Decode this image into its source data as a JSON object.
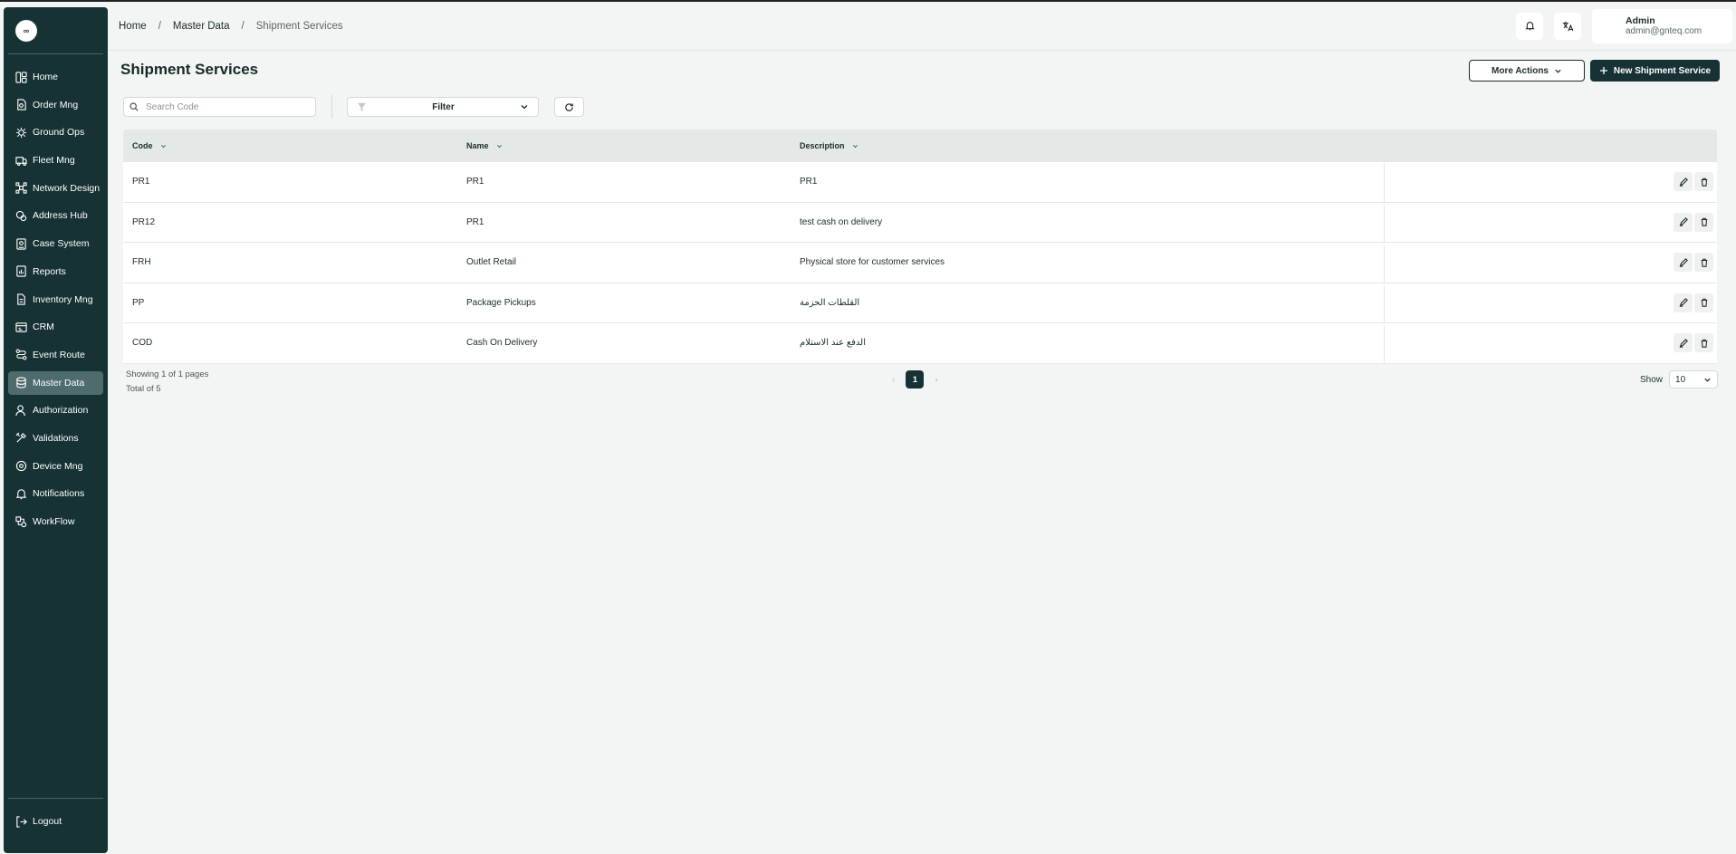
{
  "sidebar": {
    "logo": "∞",
    "items": [
      {
        "label": "Home",
        "icon": "home-icon"
      },
      {
        "label": "Order Mng",
        "icon": "order-icon"
      },
      {
        "label": "Ground Ops",
        "icon": "ground-ops-icon"
      },
      {
        "label": "Fleet Mng",
        "icon": "truck-icon"
      },
      {
        "label": "Network Design",
        "icon": "network-icon"
      },
      {
        "label": "Address Hub",
        "icon": "address-icon"
      },
      {
        "label": "Case System",
        "icon": "case-icon"
      },
      {
        "label": "Reports",
        "icon": "reports-icon"
      },
      {
        "label": "Inventory Mng",
        "icon": "inventory-icon"
      },
      {
        "label": "CRM",
        "icon": "crm-icon"
      },
      {
        "label": "Event Route",
        "icon": "route-icon"
      },
      {
        "label": "Master Data",
        "icon": "database-icon",
        "active": true
      },
      {
        "label": "Authorization",
        "icon": "user-icon"
      },
      {
        "label": "Validations",
        "icon": "tools-icon"
      },
      {
        "label": "Device Mng",
        "icon": "device-icon"
      },
      {
        "label": "Notifications",
        "icon": "bell-icon"
      },
      {
        "label": "WorkFlow",
        "icon": "workflow-icon"
      }
    ],
    "logout": "Logout"
  },
  "header": {
    "breadcrumb": [
      "Home",
      "Master Data",
      "Shipment Services"
    ],
    "separator": "/",
    "user": {
      "name": "Admin",
      "email": "admin@gnteq.com"
    }
  },
  "page": {
    "title": "Shipment Services",
    "more_actions": "More Actions",
    "new_button": "New Shipment Service",
    "search_placeholder": "Search Code",
    "filter_label": "Filter"
  },
  "table": {
    "columns": [
      "Code",
      "Name",
      "Description"
    ],
    "rows": [
      {
        "code": "PR1",
        "name": "PR1",
        "description": "PR1"
      },
      {
        "code": "PR12",
        "name": "PR1",
        "description": "test cash on delivery"
      },
      {
        "code": "FRH",
        "name": "Outlet Retail",
        "description": "Physical store for customer services"
      },
      {
        "code": "PP",
        "name": "Package Pickups",
        "description": "القلطات الحزمة"
      },
      {
        "code": "COD",
        "name": "Cash On Delivery",
        "description": "الدفع عند الاستلام"
      }
    ]
  },
  "pagination": {
    "showing": "Showing 1 of 1 pages",
    "total": "Total of 5",
    "current_page": "1",
    "show_label": "Show",
    "page_size": "10"
  },
  "colors": {
    "sidebar_bg": "#173235",
    "accent": "#173235",
    "active_item": "#4e6b6e"
  }
}
